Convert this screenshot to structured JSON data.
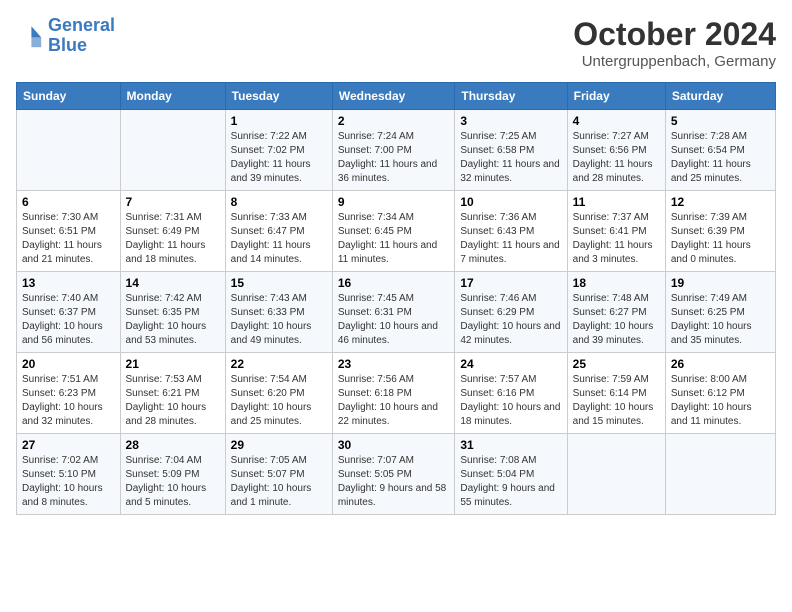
{
  "header": {
    "logo_line1": "General",
    "logo_line2": "Blue",
    "month": "October 2024",
    "location": "Untergruppenbach, Germany"
  },
  "weekdays": [
    "Sunday",
    "Monday",
    "Tuesday",
    "Wednesday",
    "Thursday",
    "Friday",
    "Saturday"
  ],
  "weeks": [
    [
      {
        "day": "",
        "info": ""
      },
      {
        "day": "",
        "info": ""
      },
      {
        "day": "1",
        "info": "Sunrise: 7:22 AM\nSunset: 7:02 PM\nDaylight: 11 hours and 39 minutes."
      },
      {
        "day": "2",
        "info": "Sunrise: 7:24 AM\nSunset: 7:00 PM\nDaylight: 11 hours and 36 minutes."
      },
      {
        "day": "3",
        "info": "Sunrise: 7:25 AM\nSunset: 6:58 PM\nDaylight: 11 hours and 32 minutes."
      },
      {
        "day": "4",
        "info": "Sunrise: 7:27 AM\nSunset: 6:56 PM\nDaylight: 11 hours and 28 minutes."
      },
      {
        "day": "5",
        "info": "Sunrise: 7:28 AM\nSunset: 6:54 PM\nDaylight: 11 hours and 25 minutes."
      }
    ],
    [
      {
        "day": "6",
        "info": "Sunrise: 7:30 AM\nSunset: 6:51 PM\nDaylight: 11 hours and 21 minutes."
      },
      {
        "day": "7",
        "info": "Sunrise: 7:31 AM\nSunset: 6:49 PM\nDaylight: 11 hours and 18 minutes."
      },
      {
        "day": "8",
        "info": "Sunrise: 7:33 AM\nSunset: 6:47 PM\nDaylight: 11 hours and 14 minutes."
      },
      {
        "day": "9",
        "info": "Sunrise: 7:34 AM\nSunset: 6:45 PM\nDaylight: 11 hours and 11 minutes."
      },
      {
        "day": "10",
        "info": "Sunrise: 7:36 AM\nSunset: 6:43 PM\nDaylight: 11 hours and 7 minutes."
      },
      {
        "day": "11",
        "info": "Sunrise: 7:37 AM\nSunset: 6:41 PM\nDaylight: 11 hours and 3 minutes."
      },
      {
        "day": "12",
        "info": "Sunrise: 7:39 AM\nSunset: 6:39 PM\nDaylight: 11 hours and 0 minutes."
      }
    ],
    [
      {
        "day": "13",
        "info": "Sunrise: 7:40 AM\nSunset: 6:37 PM\nDaylight: 10 hours and 56 minutes."
      },
      {
        "day": "14",
        "info": "Sunrise: 7:42 AM\nSunset: 6:35 PM\nDaylight: 10 hours and 53 minutes."
      },
      {
        "day": "15",
        "info": "Sunrise: 7:43 AM\nSunset: 6:33 PM\nDaylight: 10 hours and 49 minutes."
      },
      {
        "day": "16",
        "info": "Sunrise: 7:45 AM\nSunset: 6:31 PM\nDaylight: 10 hours and 46 minutes."
      },
      {
        "day": "17",
        "info": "Sunrise: 7:46 AM\nSunset: 6:29 PM\nDaylight: 10 hours and 42 minutes."
      },
      {
        "day": "18",
        "info": "Sunrise: 7:48 AM\nSunset: 6:27 PM\nDaylight: 10 hours and 39 minutes."
      },
      {
        "day": "19",
        "info": "Sunrise: 7:49 AM\nSunset: 6:25 PM\nDaylight: 10 hours and 35 minutes."
      }
    ],
    [
      {
        "day": "20",
        "info": "Sunrise: 7:51 AM\nSunset: 6:23 PM\nDaylight: 10 hours and 32 minutes."
      },
      {
        "day": "21",
        "info": "Sunrise: 7:53 AM\nSunset: 6:21 PM\nDaylight: 10 hours and 28 minutes."
      },
      {
        "day": "22",
        "info": "Sunrise: 7:54 AM\nSunset: 6:20 PM\nDaylight: 10 hours and 25 minutes."
      },
      {
        "day": "23",
        "info": "Sunrise: 7:56 AM\nSunset: 6:18 PM\nDaylight: 10 hours and 22 minutes."
      },
      {
        "day": "24",
        "info": "Sunrise: 7:57 AM\nSunset: 6:16 PM\nDaylight: 10 hours and 18 minutes."
      },
      {
        "day": "25",
        "info": "Sunrise: 7:59 AM\nSunset: 6:14 PM\nDaylight: 10 hours and 15 minutes."
      },
      {
        "day": "26",
        "info": "Sunrise: 8:00 AM\nSunset: 6:12 PM\nDaylight: 10 hours and 11 minutes."
      }
    ],
    [
      {
        "day": "27",
        "info": "Sunrise: 7:02 AM\nSunset: 5:10 PM\nDaylight: 10 hours and 8 minutes."
      },
      {
        "day": "28",
        "info": "Sunrise: 7:04 AM\nSunset: 5:09 PM\nDaylight: 10 hours and 5 minutes."
      },
      {
        "day": "29",
        "info": "Sunrise: 7:05 AM\nSunset: 5:07 PM\nDaylight: 10 hours and 1 minute."
      },
      {
        "day": "30",
        "info": "Sunrise: 7:07 AM\nSunset: 5:05 PM\nDaylight: 9 hours and 58 minutes."
      },
      {
        "day": "31",
        "info": "Sunrise: 7:08 AM\nSunset: 5:04 PM\nDaylight: 9 hours and 55 minutes."
      },
      {
        "day": "",
        "info": ""
      },
      {
        "day": "",
        "info": ""
      }
    ]
  ]
}
